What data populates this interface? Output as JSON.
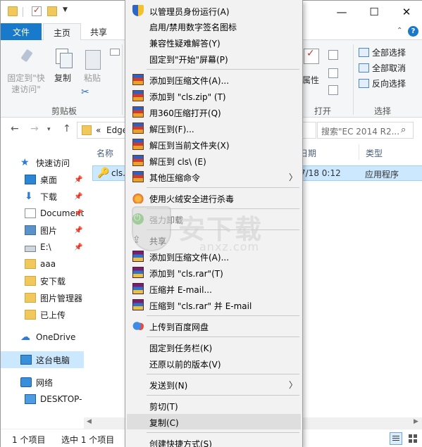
{
  "ribbon_tabs": {
    "file": "文件",
    "home": "主页",
    "share": "共享"
  },
  "ribbon": {
    "pin_label": "固定到\"快速访问\"",
    "copy_label": "复制",
    "paste_label": "粘贴",
    "clipboard_group": "剪贴板",
    "properties_label": "属性",
    "open_group": "打开",
    "select_group": "选择",
    "select_all": "全部选择",
    "select_none": "全部取消",
    "invert_selection": "反向选择"
  },
  "address": {
    "crumb_prefix": "«",
    "crumb": "Edge",
    "search_placeholder": "搜索\"EC 2014 R2..."
  },
  "nav": {
    "items": [
      {
        "label": "快速访问"
      },
      {
        "label": "桌面"
      },
      {
        "label": "下载"
      },
      {
        "label": "Documents"
      },
      {
        "label": "图片"
      },
      {
        "label": "E:\\"
      },
      {
        "label": "aaa"
      },
      {
        "label": "安下载"
      },
      {
        "label": "图片管理器"
      },
      {
        "label": "已上传"
      },
      {
        "label": "OneDrive"
      },
      {
        "label": "这台电脑"
      },
      {
        "label": "网络"
      },
      {
        "label": "DESKTOP-"
      }
    ]
  },
  "columns": {
    "name": "名称",
    "date": "日期",
    "type": "类型"
  },
  "file": {
    "name": "cls.",
    "date": "7/18 0:12",
    "type": "应用程序"
  },
  "status": {
    "count": "1 个项目",
    "selected": "选中 1 个项目"
  },
  "menu": {
    "items": [
      {
        "label": "以管理员身份运行(A)",
        "icon": "shield-icon"
      },
      {
        "label": "启用/禁用数字签名图标"
      },
      {
        "label": "兼容性疑难解答(Y)"
      },
      {
        "label": "固定到\"开始\"屏幕(P)"
      },
      {
        "label": "添加到压缩文件(A)...",
        "icon": "archive-icon"
      },
      {
        "label": "添加到 \"cls.zip\" (T)",
        "icon": "archive-icon"
      },
      {
        "label": "用360压缩打开(Q)",
        "icon": "archive-icon"
      },
      {
        "label": "解压到(F)...",
        "icon": "archive-icon"
      },
      {
        "label": "解压到当前文件夹(X)",
        "icon": "archive-icon"
      },
      {
        "label": "解压到 cls\\ (E)",
        "icon": "archive-icon"
      },
      {
        "label": "其他压缩命令",
        "icon": "archive-icon"
      },
      {
        "label": "使用火绒安全进行杀毒",
        "icon": "fire-icon"
      },
      {
        "label": "强力卸载",
        "icon": "power-icon"
      },
      {
        "label": "共享",
        "icon": "share-icon"
      },
      {
        "label": "添加到压缩文件(A)...",
        "icon": "archive-icon-alt"
      },
      {
        "label": "添加到 \"cls.rar\"(T)",
        "icon": "archive-icon-alt"
      },
      {
        "label": "压缩并 E-mail...",
        "icon": "archive-icon-alt"
      },
      {
        "label": "压缩到 \"cls.rar\" 并 E-mail",
        "icon": "archive-icon-alt"
      },
      {
        "label": "上传到百度网盘",
        "icon": "cloud-icon"
      },
      {
        "label": "固定到任务栏(K)"
      },
      {
        "label": "还原以前的版本(V)"
      },
      {
        "label": "发送到(N)"
      },
      {
        "label": "剪切(T)"
      },
      {
        "label": "复制(C)"
      },
      {
        "label": "创建快捷方式(S)"
      }
    ]
  },
  "watermark": {
    "text": "安下载",
    "sub": "anxz.com"
  }
}
